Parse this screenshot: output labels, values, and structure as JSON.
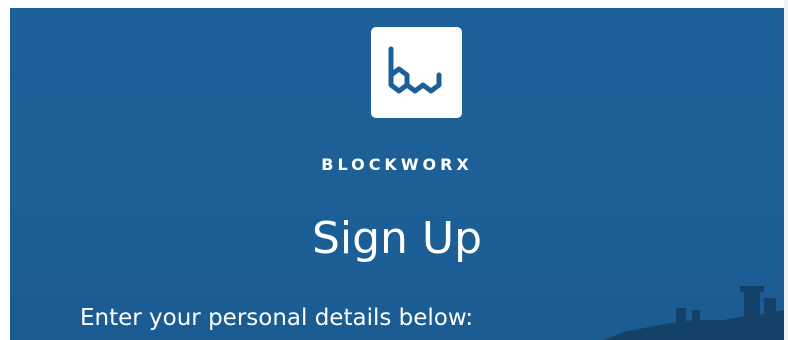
{
  "brand": {
    "logo_icon": "blockworx-bw-logo",
    "name": "BLOCKWORX"
  },
  "form": {
    "title": "Sign Up",
    "subtitle": "Enter your personal details below:"
  },
  "colors": {
    "background": "#1c5f99",
    "logo_background": "#ffffff",
    "logo_mark": "#1c5f99",
    "text": "#ffffff"
  }
}
